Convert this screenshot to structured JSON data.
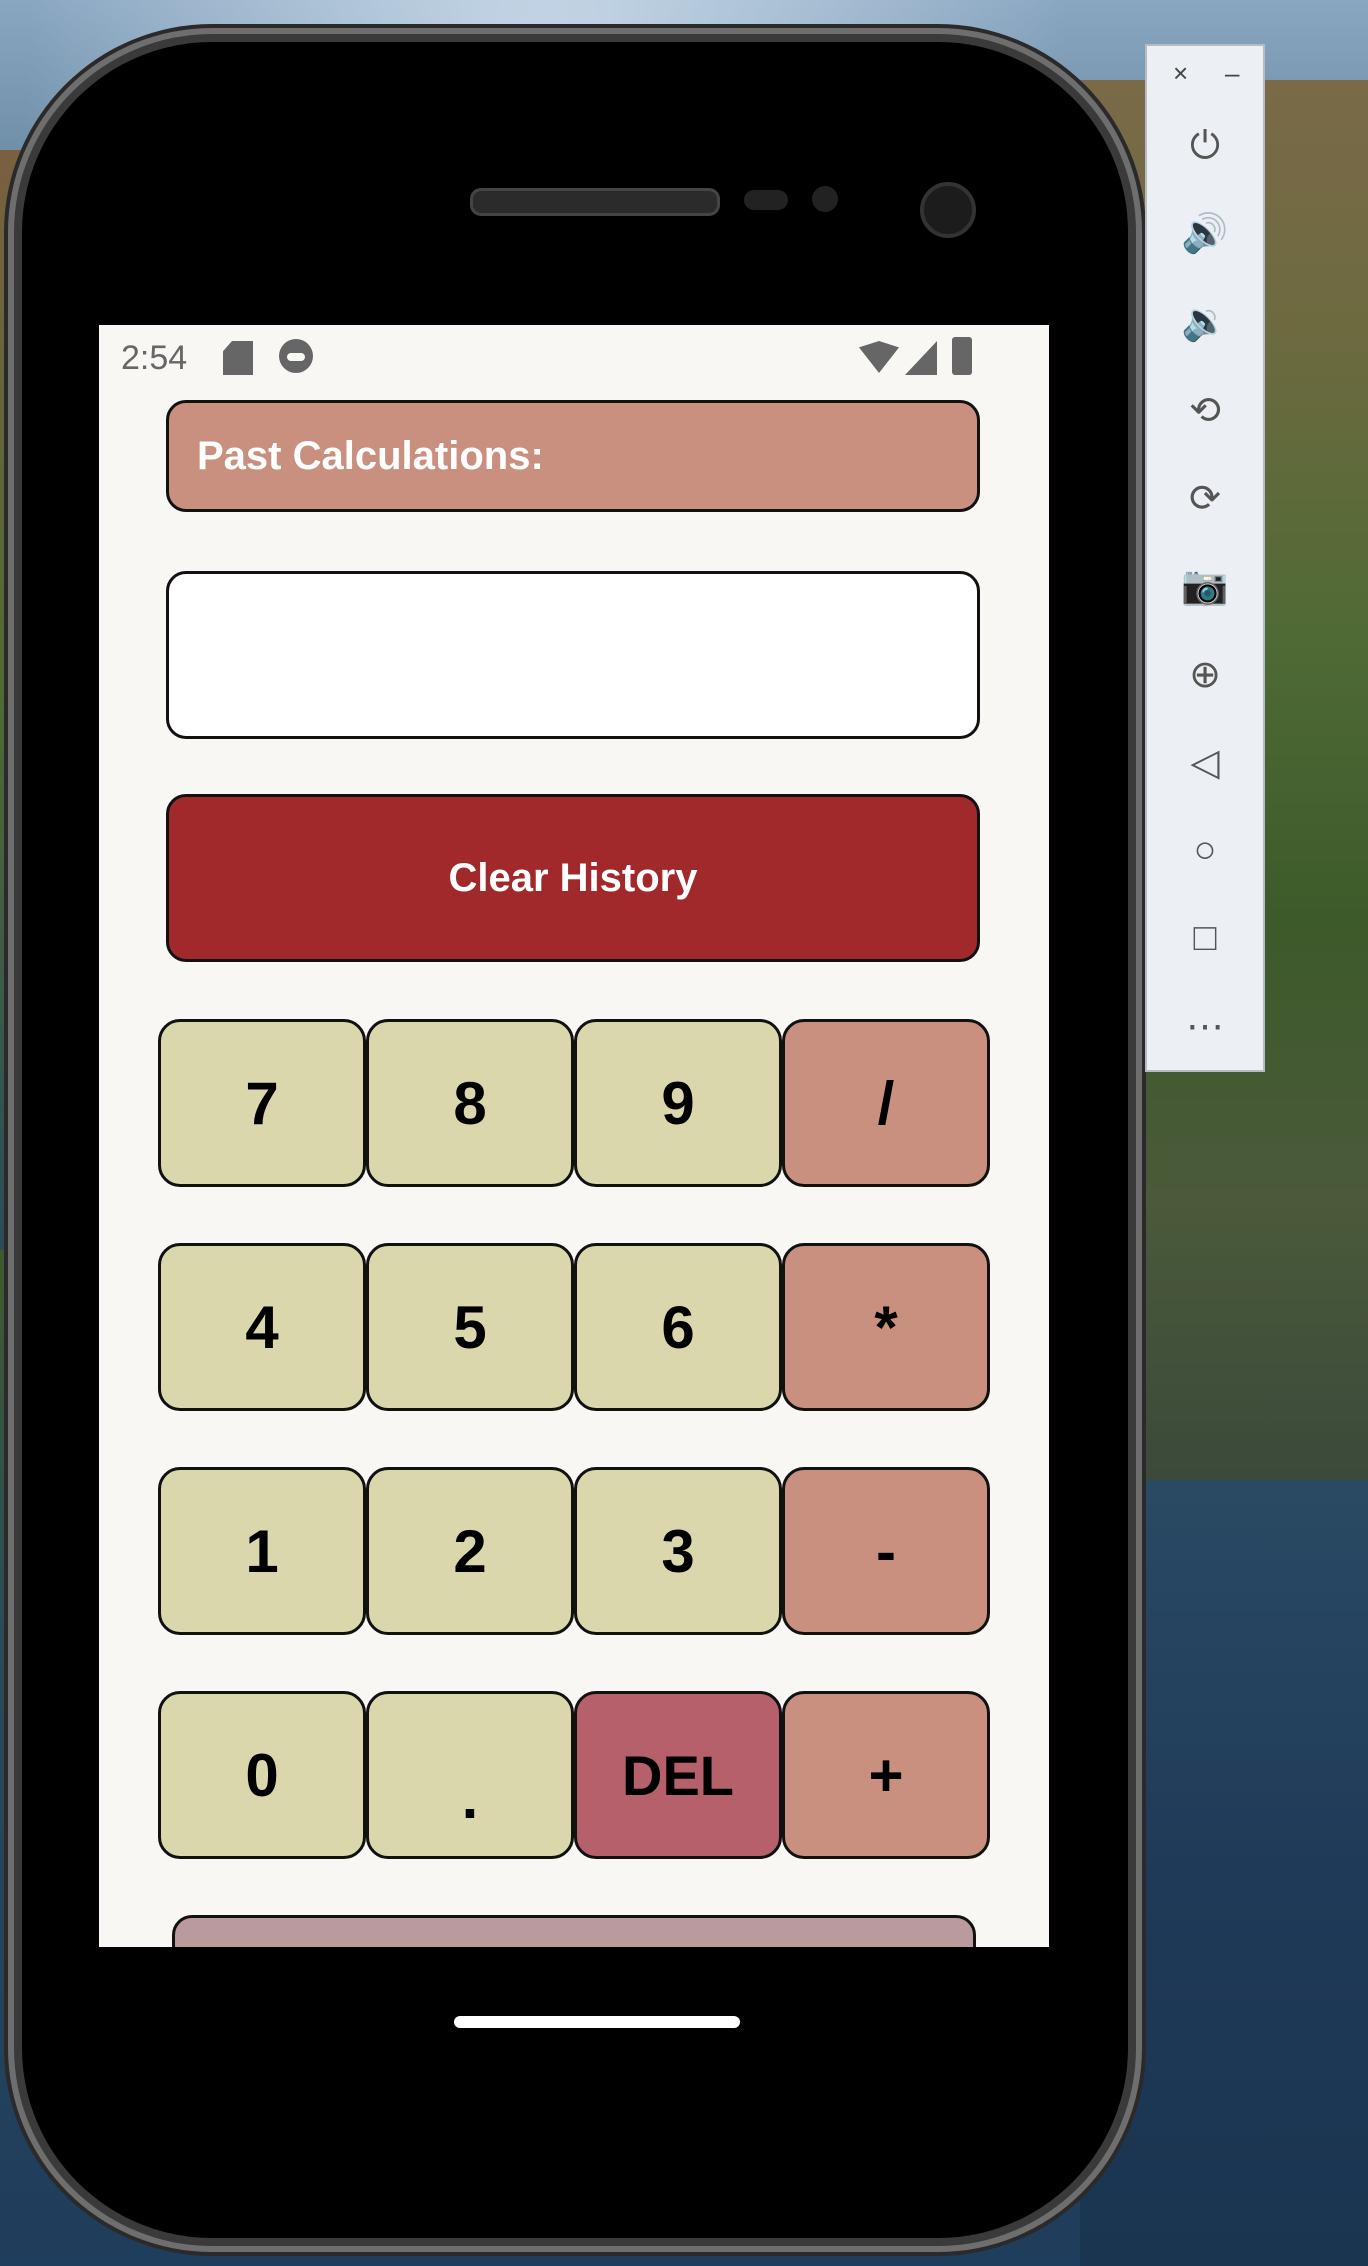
{
  "status_bar": {
    "time": "2:54"
  },
  "calculator": {
    "past_label": "Past Calculations:",
    "history_text": "",
    "clear_label": "Clear History",
    "keys": [
      {
        "label": "7",
        "kind": "num"
      },
      {
        "label": "8",
        "kind": "num"
      },
      {
        "label": "9",
        "kind": "num"
      },
      {
        "label": "/",
        "kind": "op"
      },
      {
        "label": "4",
        "kind": "num"
      },
      {
        "label": "5",
        "kind": "num"
      },
      {
        "label": "6",
        "kind": "num"
      },
      {
        "label": "*",
        "kind": "op"
      },
      {
        "label": "1",
        "kind": "num"
      },
      {
        "label": "2",
        "kind": "num"
      },
      {
        "label": "3",
        "kind": "num"
      },
      {
        "label": "-",
        "kind": "op"
      },
      {
        "label": "0",
        "kind": "num"
      },
      {
        "label": ".",
        "kind": "num"
      },
      {
        "label": "DEL",
        "kind": "del"
      },
      {
        "label": "+",
        "kind": "op"
      }
    ]
  },
  "emulator_toolbar": {
    "close_glyph": "×",
    "minimize_glyph": "–",
    "items": [
      {
        "icon": "power-icon",
        "glyph": "⏻"
      },
      {
        "icon": "volume-up-icon",
        "glyph": "🔊"
      },
      {
        "icon": "volume-down-icon",
        "glyph": "🔉"
      },
      {
        "icon": "rotate-left-icon",
        "glyph": "⟲"
      },
      {
        "icon": "rotate-right-icon",
        "glyph": "⟳"
      },
      {
        "icon": "camera-icon",
        "glyph": "📷"
      },
      {
        "icon": "zoom-icon",
        "glyph": "⊕"
      },
      {
        "icon": "back-icon",
        "glyph": "◁"
      },
      {
        "icon": "home-icon",
        "glyph": "○"
      },
      {
        "icon": "overview-icon",
        "glyph": "□"
      },
      {
        "icon": "more-icon",
        "glyph": "⋯"
      }
    ]
  },
  "colors": {
    "number_key": "#dbd7ad",
    "operator_key": "#c98f7f",
    "delete_key": "#b5606b",
    "clear_button": "#a1292b",
    "screen_background": "#f9f7f4"
  }
}
